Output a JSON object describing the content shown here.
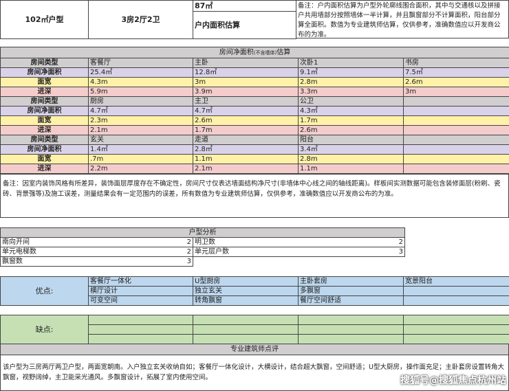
{
  "header": {
    "unit_type": "102㎡户型",
    "layout": "3房2厅2卫",
    "area_value": "87㎡",
    "area_label": "户内面积估算",
    "note": "备注：户内面积估算为户型外轮廓线围合面积，其中与交通核以及拼接户共用墙部分按照墙体一半计算，并且飘窗部分不计算面积，阳台部分算全面积。数值为专业建筑师估算，仅供参考，准确数值应以开发商公布的为准。"
  },
  "rooms": {
    "title": "房间净面积",
    "title_sub": "(不含墙体)",
    "title_tail": "估算",
    "groups": [
      {
        "labels": [
          "房间类型",
          "房间净面积",
          "面宽",
          "进深"
        ],
        "rows": [
          [
            "客餐厅",
            "主卧",
            "次卧1",
            "书房"
          ],
          [
            "25.4㎡",
            "12.8㎡",
            "9.1㎡",
            "7.5㎡"
          ],
          [
            "4.3m",
            "3m",
            "2.8m",
            "2.6m"
          ],
          [
            "5.9m",
            "3.9m",
            "3.3m",
            "3m"
          ]
        ]
      },
      {
        "labels": [
          "房间类型",
          "房间净面积",
          "面宽",
          "进深"
        ],
        "rows": [
          [
            "厨房",
            "主卫",
            "公卫",
            ""
          ],
          [
            "4.7㎡",
            "4.7㎡",
            "4.3㎡",
            ""
          ],
          [
            "2.3m",
            "2.6m",
            "1.7m",
            ""
          ],
          [
            "2.1m",
            "1.7m",
            "2.6m",
            ""
          ]
        ]
      },
      {
        "labels": [
          "房间类型",
          "房间净面积",
          "面宽",
          "进深"
        ],
        "rows": [
          [
            "玄关",
            "走道",
            "阳台",
            ""
          ],
          [
            "1.4㎡",
            "2.8㎡",
            "3.4㎡",
            ""
          ],
          [
            ".7m",
            "1.1m",
            "2.8m",
            ""
          ],
          [
            "2.2m",
            "2.1m",
            "1.1m",
            ""
          ]
        ]
      }
    ],
    "note": "备注：因室内装饰风格有所差异，装饰面层厚度存在不确定性，房间尺寸仅表达墙面结构净尺寸(非墙体中心线之间的轴线距离)。样板间实测数据可能包含装修面层(粉刷、瓷砖、背景强等)及施工误差，测量结果会有一定范围内的误差，所有数值为专业建筑师估算，仅供参考，准确数值应以开发商公布的为准。"
  },
  "analysis": {
    "title": "户型分析",
    "rows": [
      {
        "l_label": "南向开间",
        "l_value": "2",
        "r_label": "明卫数",
        "r_value": "2"
      },
      {
        "l_label": "单元电梯数",
        "l_value": "2",
        "r_label": "单元层户数",
        "r_value": "3"
      },
      {
        "l_label": "飘窗数",
        "l_value": "3",
        "r_label": "",
        "r_value": ""
      }
    ]
  },
  "pros": {
    "label": "优点:",
    "rows": [
      [
        "客餐厅一体化",
        "U型厨房",
        "主卧套房",
        "宽景阳台"
      ],
      [
        "横厅设计",
        "独立玄关",
        "多飘窗",
        ""
      ],
      [
        "可变空间",
        "转角飘窗",
        "餐厅空间舒适",
        ""
      ]
    ]
  },
  "cons": {
    "label": "缺点:"
  },
  "review": {
    "title": "专业建筑师点评",
    "text": "该户型为三房两厅两卫户型，两面宽朝南。入户独立玄关收纳自如；客餐厅一体化设计，大横设计，结合超大飘窗，空间舒适；U型大厨房，操作面充足；主卧套房设置转角大飘窗，视野阔绰，主卫能采光通风。多飘窗设计，拓展了室内使用空间。"
  },
  "watermark": "搜狐号@搜狐焦点杭州站"
}
